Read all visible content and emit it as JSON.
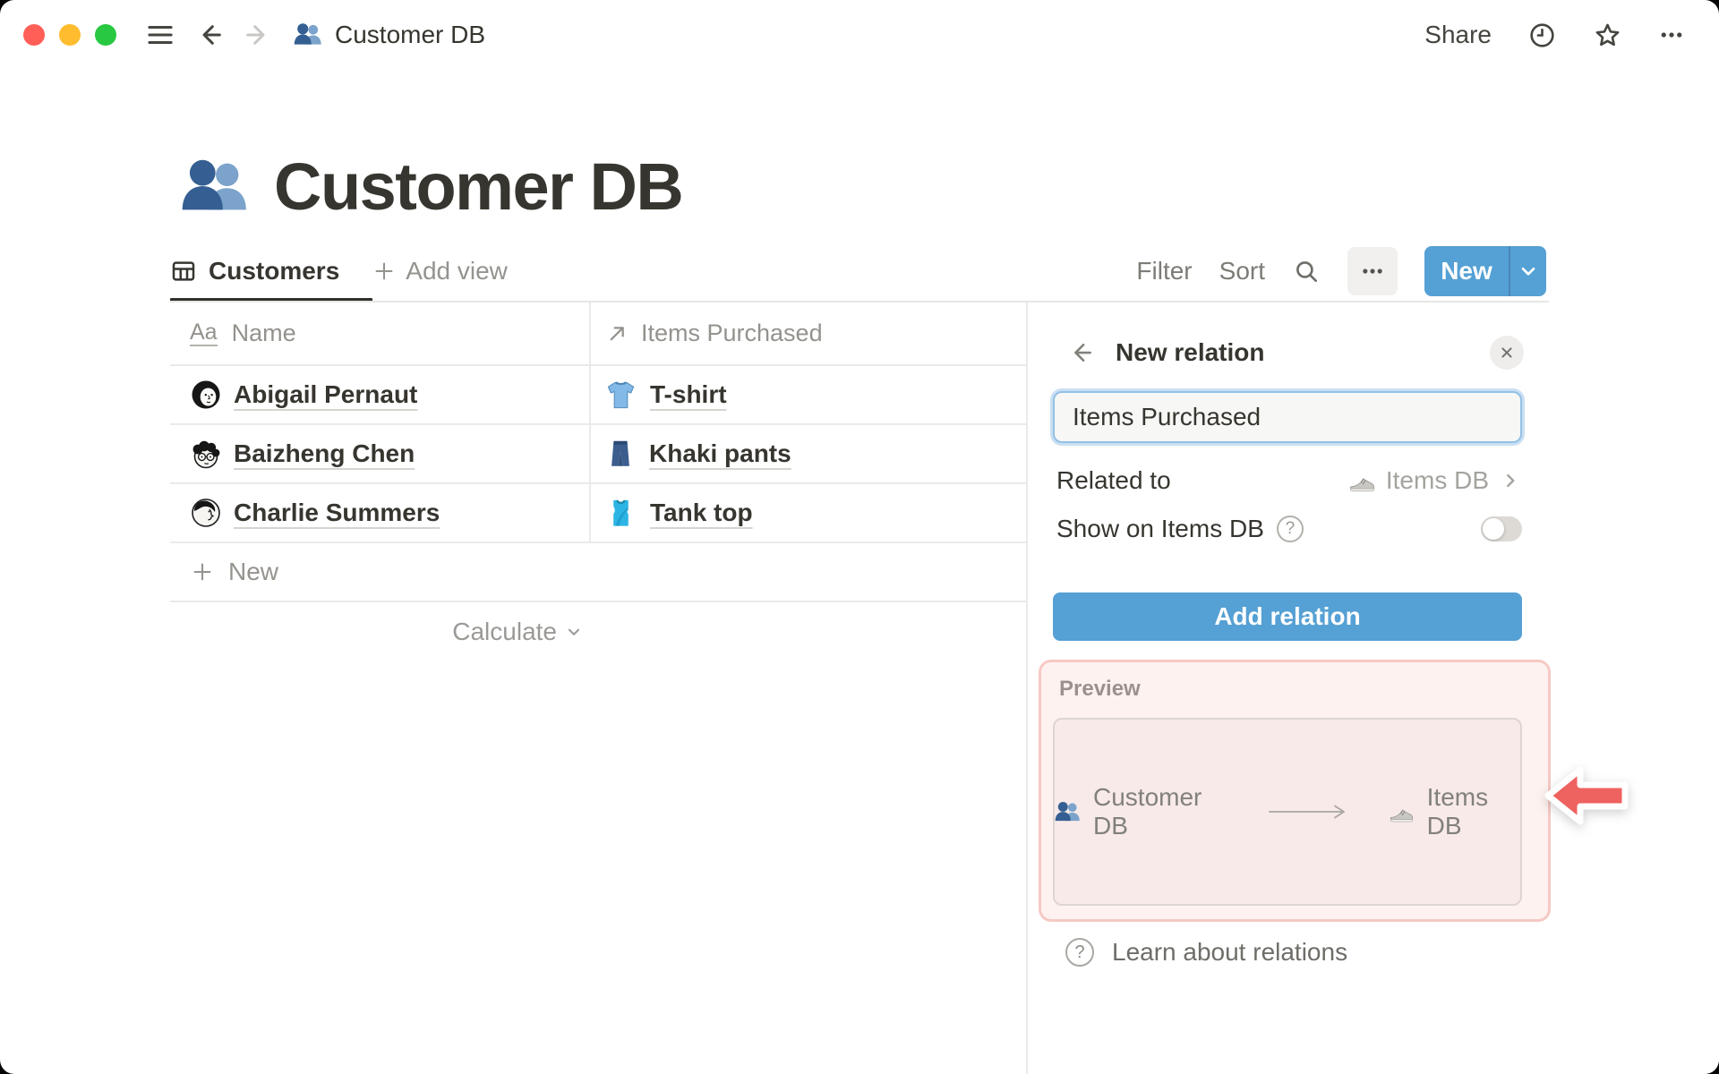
{
  "titlebar": {
    "title": "Customer DB",
    "share_label": "Share",
    "icons": [
      "hamburger-icon",
      "back-arrow-icon",
      "forward-arrow-icon",
      "people-icon",
      "clock-icon",
      "star-icon",
      "ellipsis-icon"
    ]
  },
  "page": {
    "icon": "people-icon",
    "title": "Customer DB"
  },
  "toolbar": {
    "active_view": "Customers",
    "active_view_icon": "table-icon",
    "add_view_label": "Add view",
    "filter_label": "Filter",
    "sort_label": "Sort",
    "search_icon": "search-icon",
    "more_icon": "ellipsis-icon",
    "new_button_label": "New"
  },
  "table": {
    "header": {
      "name_label": "Name",
      "name_icon": "text-property-icon",
      "items_label": "Items Purchased",
      "items_icon": "relation-arrow-icon"
    },
    "rows": [
      {
        "name": "Abigail Pernaut",
        "avatar_icon": "woman-bob-avatar",
        "item": "T-shirt",
        "item_icon": "tshirt-icon"
      },
      {
        "name": "Baizheng Chen",
        "avatar_icon": "curly-glasses-avatar",
        "item": "Khaki pants",
        "item_icon": "jeans-icon"
      },
      {
        "name": "Charlie Summers",
        "avatar_icon": "profile-avatar",
        "item": "Tank top",
        "item_icon": "tanktop-icon"
      }
    ],
    "new_row_label": "New",
    "calculate_label": "Calculate"
  },
  "panel": {
    "title": "New relation",
    "relation_name_value": "Items Purchased",
    "related_to_label": "Related to",
    "related_to_value": "Items DB",
    "related_to_icon": "sneaker-icon",
    "show_on_label": "Show on Items DB",
    "toggle_state": "off",
    "add_relation_button": "Add relation",
    "preview": {
      "label": "Preview",
      "source": "Customer DB",
      "source_icon": "people-icon",
      "target": "Items DB",
      "target_icon": "sneaker-icon"
    },
    "learn_link": "Learn about relations"
  },
  "colors": {
    "accent_blue": "#55a0d4",
    "input_focus_blue": "#94c1e5",
    "highlight_pink_border": "#f6c9c4",
    "highlight_pink_bg": "#fdf2f0",
    "annotation_arrow_red": "#ee625f",
    "text_dark": "#37352f",
    "text_grey": "#95938e"
  }
}
